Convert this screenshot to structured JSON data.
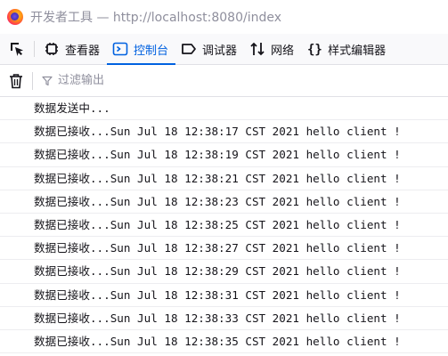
{
  "window": {
    "title": "开发者工具 — http://localhost:8080/index"
  },
  "toolbar": {
    "tabs": [
      {
        "label": "查看器",
        "icon": "inspector-icon",
        "active": false
      },
      {
        "label": "控制台",
        "icon": "console-icon",
        "active": true
      },
      {
        "label": "调试器",
        "icon": "debugger-icon",
        "active": false
      },
      {
        "label": "网络",
        "icon": "network-icon",
        "active": false
      },
      {
        "label": "样式编辑器",
        "icon": "style-editor-icon",
        "active": false
      }
    ]
  },
  "filter": {
    "placeholder": "过滤输出"
  },
  "console": {
    "messages": [
      "数据发送中...",
      "数据已接收...Sun Jul 18 12:38:17 CST 2021 hello client !",
      "数据已接收...Sun Jul 18 12:38:19 CST 2021 hello client !",
      "数据已接收...Sun Jul 18 12:38:21 CST 2021 hello client !",
      "数据已接收...Sun Jul 18 12:38:23 CST 2021 hello client !",
      "数据已接收...Sun Jul 18 12:38:25 CST 2021 hello client !",
      "数据已接收...Sun Jul 18 12:38:27 CST 2021 hello client !",
      "数据已接收...Sun Jul 18 12:38:29 CST 2021 hello client !",
      "数据已接收...Sun Jul 18 12:38:31 CST 2021 hello client !",
      "数据已接收...Sun Jul 18 12:38:33 CST 2021 hello client !",
      "数据已接收...Sun Jul 18 12:38:35 CST 2021 hello client !"
    ]
  },
  "colors": {
    "accent": "#0061e0",
    "muted": "#8f8f9d"
  }
}
